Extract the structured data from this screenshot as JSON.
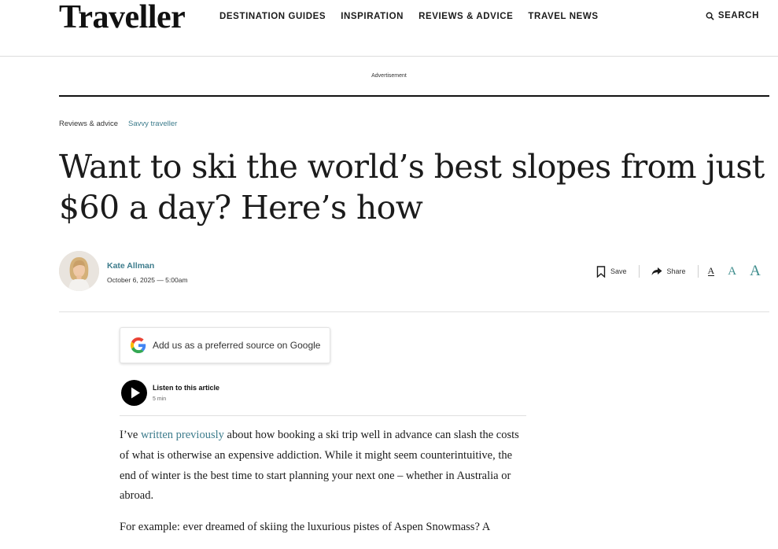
{
  "header": {
    "logo": "Traveller",
    "nav": [
      "DESTINATION GUIDES",
      "INSPIRATION",
      "REVIEWS & ADVICE",
      "TRAVEL NEWS"
    ],
    "search_label": "SEARCH"
  },
  "advertisement_label": "Advertisement",
  "breadcrumb": {
    "section": "Reviews & advice",
    "subsection": "Savvy traveller"
  },
  "article": {
    "title": "Want to ski the world’s best slopes from just $60 a day? Here’s how",
    "author": "Kate Allman",
    "date": "October 6, 2025 — 5:00am"
  },
  "toolbar": {
    "save_label": "Save",
    "share_label": "Share",
    "font_sizes": [
      "A",
      "A",
      "A"
    ]
  },
  "google_button": {
    "label": "Add us as a preferred source on Google"
  },
  "audio": {
    "label": "Listen to this article",
    "duration": "5 min"
  },
  "body": {
    "p1_before": "I’ve ",
    "p1_link": "written previously",
    "p1_after": " about how booking a ski trip well in advance can slash the costs of what is otherwise an expensive addiction. While it might seem counterintuitive, the end of winter is the best time to start planning your next one – whether in Australia or abroad.",
    "p2": "For example: ever dreamed of skiing the luxurious pistes of Aspen Snowmass? A"
  },
  "colors": {
    "accent": "#3d7c8c",
    "text": "#1b1b1b"
  }
}
